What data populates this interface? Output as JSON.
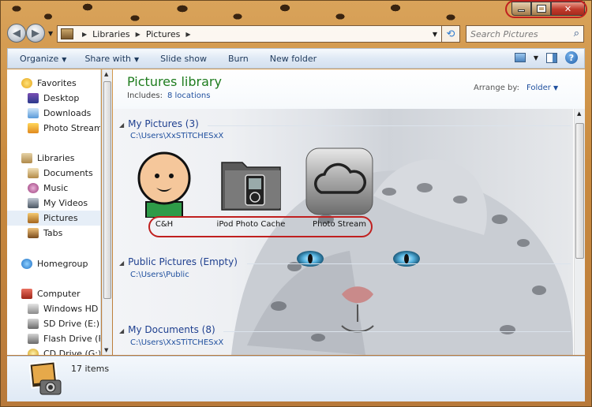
{
  "window": {
    "caption": {
      "minimize": "minimize",
      "maximize": "maximize",
      "close": "close"
    }
  },
  "address": {
    "crumbs": [
      "Libraries",
      "Pictures"
    ]
  },
  "search": {
    "placeholder": "Search Pictures"
  },
  "toolbar": {
    "organize": "Organize",
    "share_with": "Share with",
    "slide_show": "Slide show",
    "burn": "Burn",
    "new_folder": "New folder"
  },
  "nav": {
    "favorites_header": "Favorites",
    "favorites": [
      "Desktop",
      "Downloads",
      "Photo Stream"
    ],
    "libraries_header": "Libraries",
    "libraries": [
      "Documents",
      "Music",
      "My Videos",
      "Pictures",
      "Tabs"
    ],
    "homegroup": "Homegroup",
    "computer_header": "Computer",
    "drives": [
      "Windows HD (C",
      "SD Drive (E:)",
      "Flash Drive (F:)",
      "CD Drive (G:)"
    ]
  },
  "library": {
    "title": "Pictures library",
    "includes_label": "Includes:",
    "includes_link": "8 locations",
    "arrange_label": "Arrange by:",
    "arrange_value": "Folder"
  },
  "sections": [
    {
      "title": "My Pictures (3)",
      "path": "C:\\Users\\XxSTiTCHESxX"
    },
    {
      "title": "Public Pictures (Empty)",
      "path": "C:\\Users\\Public"
    },
    {
      "title": "My Documents (8)",
      "path": "C:\\Users\\XxSTiTCHESxX"
    }
  ],
  "tiles": [
    {
      "label": "C&H"
    },
    {
      "label": "iPod Photo Cache"
    },
    {
      "label": "Photo Stream"
    }
  ],
  "details": {
    "count": "17 items"
  },
  "colors": {
    "accent_red": "#c0201f",
    "title_green": "#1e7c1e",
    "link_blue": "#1f4f9e"
  }
}
